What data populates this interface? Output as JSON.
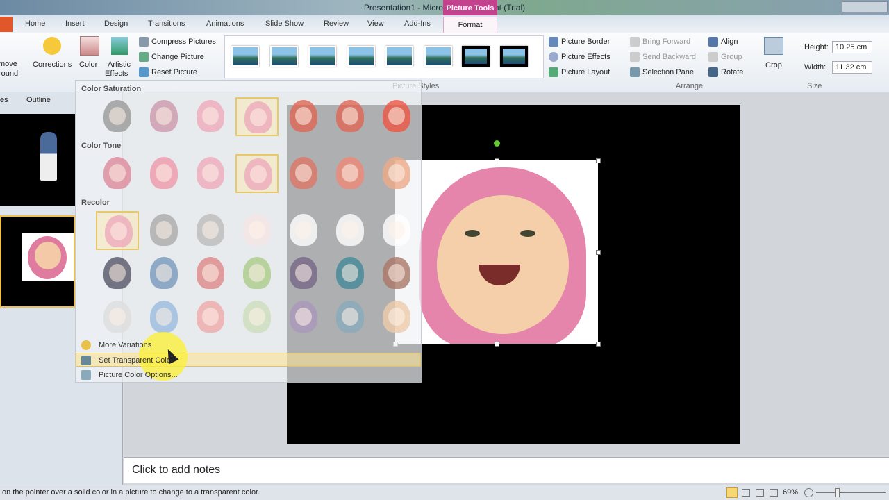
{
  "window": {
    "title": "Presentation1  -  Microsoft PowerPoint (Trial)",
    "context_tab_group": "Picture Tools"
  },
  "tabs": [
    "Home",
    "Insert",
    "Design",
    "Transitions",
    "Animations",
    "Slide Show",
    "Review",
    "View",
    "Add-Ins"
  ],
  "active_tab": "Format",
  "ribbon": {
    "adjust": {
      "remove_bg": [
        "move",
        "round"
      ],
      "corrections": "Corrections",
      "color": "Color",
      "artistic": [
        "Artistic",
        "Effects"
      ],
      "compress": "Compress Pictures",
      "change": "Change Picture",
      "reset": "Reset Picture"
    },
    "picture_styles": {
      "label": "Picture Styles",
      "border": "Picture Border",
      "effects": "Picture Effects",
      "layout": "Picture Layout"
    },
    "arrange": {
      "label": "Arrange",
      "bring_forward": "Bring Forward",
      "send_backward": "Send Backward",
      "selection_pane": "Selection Pane",
      "align": "Align",
      "group": "Group",
      "rotate": "Rotate"
    },
    "size": {
      "label": "Size",
      "crop": "Crop",
      "height_label": "Height:",
      "height_value": "10.25 cm",
      "width_label": "Width:",
      "width_value": "11.32 cm"
    }
  },
  "left_panel": {
    "tabs": [
      "es",
      "Outline"
    ]
  },
  "color_menu": {
    "sections": [
      "Color Saturation",
      "Color Tone",
      "Recolor"
    ],
    "rows": [
      {
        "tints": [
          "#999",
          "#c9a",
          "#eab",
          "#eab",
          "#d65",
          "#d65",
          "#e54"
        ],
        "selected": 3
      },
      {
        "tints": [
          "#d89",
          "#e9a",
          "#eab",
          "#eab",
          "#d76",
          "#e87",
          "#ea8"
        ],
        "selected": 3
      },
      {
        "tints": [
          "#eab",
          "#aaa",
          "#bbb",
          "#f5e5e5",
          "#fff",
          "#fff",
          "#fff"
        ],
        "selected": 0
      },
      {
        "tints": [
          "#556",
          "#79b",
          "#d88",
          "#ac8",
          "#768",
          "#489",
          "#a76"
        ],
        "selected": -1
      },
      {
        "tints": [
          "#ddd",
          "#9bd",
          "#eaa",
          "#cdb",
          "#a9b",
          "#8ab",
          "#eca"
        ],
        "selected": -1
      }
    ],
    "items": [
      "More Variations",
      "Set Transparent Color",
      "Picture Color Options..."
    ]
  },
  "notes_placeholder": "Click to add notes",
  "status": {
    "message": "on the pointer over a solid color in a picture to change to a transparent color.",
    "zoom": "69%"
  },
  "colors": {
    "context_tab": "#c4418d",
    "file_tab": "#e2572a",
    "highlight": "#fae496"
  }
}
